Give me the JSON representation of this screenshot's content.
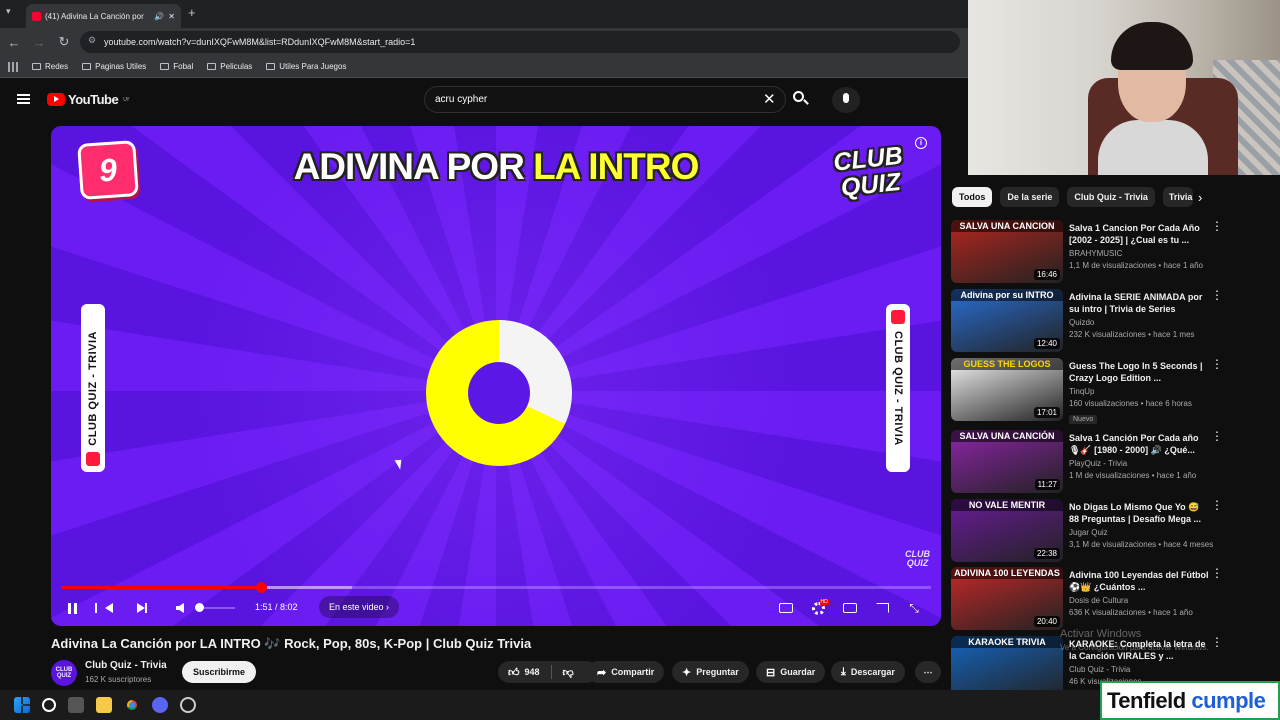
{
  "browser": {
    "tab_title": "(41) Adivina La Canción por",
    "url": "youtube.com/watch?v=dunIXQFwM8M&list=RDdunIXQFwM8M&start_radio=1",
    "bookmarks": [
      "Redes",
      "Paginas Utiles",
      "Fobal",
      "Peliculas",
      "Utiles Para Juegos"
    ]
  },
  "youtube": {
    "logo_text": "YouTube",
    "region": "UY",
    "search_value": "acru cypher"
  },
  "video": {
    "number_badge": "9",
    "banner_white": "ADIVINA POR ",
    "banner_yellow": "LA INTRO",
    "brand_line1": "CLUB",
    "brand_line2": "QUIZ",
    "side_label": "CLUB QUIZ - TRIVIA",
    "time": "1:51 / 8:02",
    "chapter": "En este video",
    "progress_fraction": 0.23,
    "buffered_fraction": 0.335,
    "countdown_fill_deg": 245
  },
  "meta": {
    "title": "Adivina La Canción por LA INTRO 🎶 Rock, Pop, 80s, K-Pop | Club Quiz Trivia",
    "channel_name": "Club Quiz - Trivia",
    "channel_avatar": "CLUB QUIZ",
    "subscribers": "162 K suscriptores",
    "subscribe": "Suscribirme",
    "likes": "948",
    "share": "Compartir",
    "ask": "Preguntar",
    "save": "Guardar",
    "download": "Descargar"
  },
  "chips": [
    "Todos",
    "De la serie",
    "Club Quiz - Trivia",
    "Trivia"
  ],
  "related": [
    {
      "thumb_text": "SALVA UNA CANCION",
      "duration": "16:46",
      "title": "Salva 1 Cancion Por Cada Año [2002 - 2025] | ¿Cual es tu ...",
      "channel": "BRAHYMUSIC",
      "meta": "1,1 M de visualizaciones • hace 1 año",
      "color": "#b3261e",
      "badge": ""
    },
    {
      "thumb_text": "Adivina por su INTRO",
      "duration": "12:40",
      "title": "Adivina la SERIE ANIMADA por su intro | Trivia de Series",
      "channel": "Quizdo",
      "meta": "232 K visualizaciones • hace 1 mes",
      "color": "#2a6fd6",
      "badge": ""
    },
    {
      "thumb_text": "GUESS THE LOGOS",
      "duration": "17:01",
      "title": "Guess The Logo In 5 Seconds | Crazy Logo Edition ...",
      "channel": "TinqUp",
      "meta": "160 visualizaciones • hace 6 horas",
      "color": "#f5f5f5",
      "badge": "Nuevo"
    },
    {
      "thumb_text": "SALVA UNA CANCIÓN",
      "duration": "11:27",
      "title": "Salva 1 Canción Por Cada año 🎙🎸 [1980 - 2000] 🔊 ¿Qué...",
      "channel": "PlayQuiz - Trivia",
      "meta": "1 M de visualizaciones • hace 1 año",
      "color": "#8e24aa",
      "badge": ""
    },
    {
      "thumb_text": "NO VALE MENTIR",
      "duration": "22:38",
      "title": "No Digas Lo Mismo Que Yo 😅 88 Preguntas | Desafío Mega ...",
      "channel": "Jugar Quiz",
      "meta": "3,1 M de visualizaciones • hace 4 meses",
      "color": "#6a1b9a",
      "badge": ""
    },
    {
      "thumb_text": "ADIVINA 100 LEYENDAS",
      "duration": "20:40",
      "title": "Adivina 100 Leyendas del Fútbol ⚽👑 ¿Cuántos ...",
      "channel": "Dosis de Cultura",
      "meta": "636 K visualizaciones • hace 1 año",
      "color": "#c62828",
      "badge": ""
    },
    {
      "thumb_text": "KARAOKE TRIVIA",
      "duration": "",
      "title": "KARAOKE: Completa la letra de la Canción VIRALES y ...",
      "channel": "Club Quiz - Trivia",
      "meta": "46 K visualizaciones",
      "color": "#1565c0",
      "badge": ""
    }
  ],
  "watermark": {
    "line1": "Activar Windows",
    "line2": "Ve a Configuración para activar Windows."
  },
  "overlay": {
    "brand": "Tenfield",
    "word": "cumple"
  }
}
